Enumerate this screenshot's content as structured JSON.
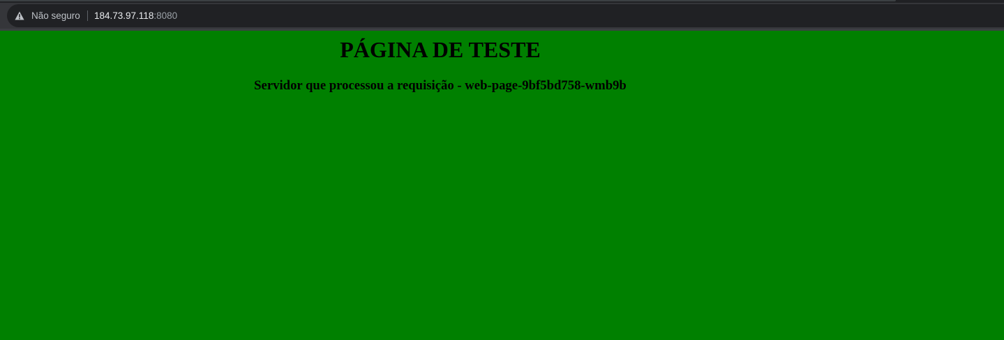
{
  "browser": {
    "security_icon": "warning-triangle-icon",
    "security_label": "Não seguro",
    "url_host": "184.73.97.118",
    "url_port": ":8080"
  },
  "page": {
    "title": "PÁGINA DE TESTE",
    "server_line": "Servidor que processou a requisição - web-page-9bf5bd758-wmb9b",
    "background_color": "#008000"
  }
}
